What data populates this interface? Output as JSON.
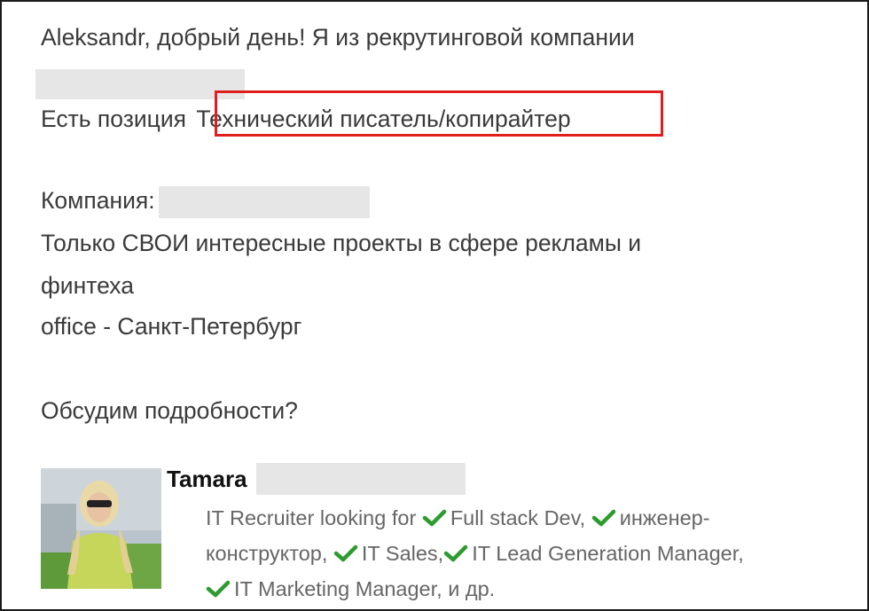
{
  "message": {
    "greeting": "Aleksandr, добрый день! Я из рекрутинговой компании",
    "position_prefix": "Есть позиция",
    "position_title": "Технический писатель/копирайтер",
    "company_label": "Компания:",
    "description_line1": "Только СВОИ интересные проекты в сфере рекламы и",
    "description_line2": "финтеха",
    "office": "office - Санкт-Петербург",
    "question": "Обсудим подробности?"
  },
  "sender": {
    "first_name": "Tamara",
    "headline_part1": "IT Recruiter looking for",
    "headline_items": [
      "Full stack Dev,",
      "инженер-",
      "конструктор,",
      "IT Sales,",
      "IT Lead Generation Manager,",
      "IT Marketing Manager, и др."
    ]
  },
  "colors": {
    "highlight": "#e01e1e",
    "check": "#2e9b2e",
    "redaction": "#e6e6e6"
  }
}
